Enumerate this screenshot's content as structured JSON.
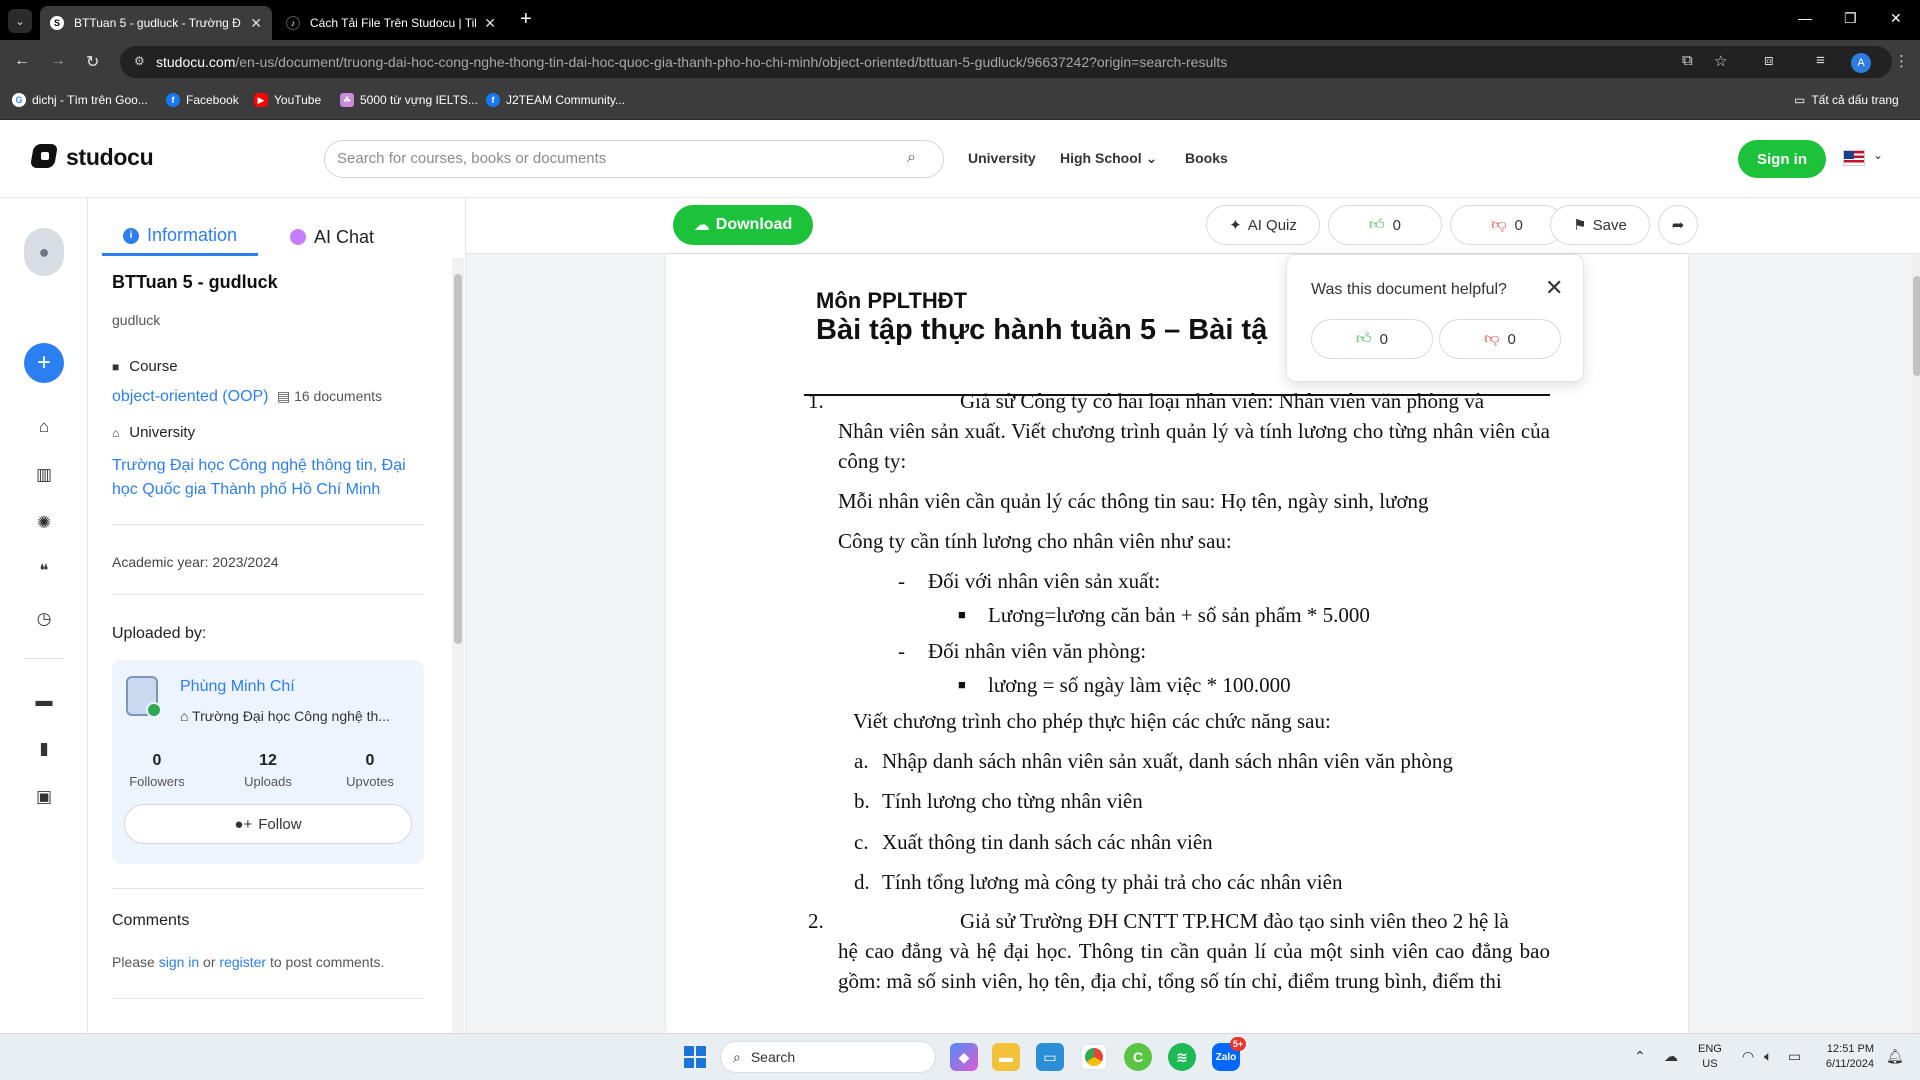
{
  "browser": {
    "tabs": [
      {
        "title": "BTTuan 5 - gudluck - Trường Đ",
        "active": true,
        "favicon": "studocu-icon"
      },
      {
        "title": "Cách Tải File Trên Studocu | Tik",
        "active": false,
        "favicon": "tiktok-icon"
      }
    ],
    "new_tab": "+",
    "window_controls": {
      "minimize": "—",
      "restore": "❐",
      "close": "✕"
    },
    "url_host": "studocu.com",
    "url_path": "/en-us/document/truong-dai-hoc-cong-nghe-thong-tin-dai-hoc-quoc-gia-thanh-pho-ho-chi-minh/object-oriented/bttuan-5-gudluck/96637242?origin=search-results",
    "profile_initial": "A",
    "bookmarks": [
      {
        "label": "dichj - Tìm trên Goo...",
        "icon": "google-icon",
        "color": "#ffffff"
      },
      {
        "label": "Facebook",
        "icon": "facebook-icon",
        "color": "#1877f2"
      },
      {
        "label": "YouTube",
        "icon": "youtube-icon",
        "color": "#ff0000"
      },
      {
        "label": "5000 từ vựng IELTS...",
        "icon": "ielts-icon",
        "color": "#c98bd9"
      },
      {
        "label": "J2TEAM Community...",
        "icon": "facebook-icon",
        "color": "#1877f2"
      }
    ],
    "all_bookmarks": "Tất cả dấu trang"
  },
  "site": {
    "logo_text": "studocu",
    "search_placeholder": "Search for courses, books or documents",
    "nav": [
      "University",
      "High School",
      "Books"
    ],
    "sign_in": "Sign in",
    "brand_color": "#1cc33a",
    "accent_color": "#2b7ff0"
  },
  "panel": {
    "tab_info": "Information",
    "tab_ai": "AI Chat",
    "doc_title": "BTTuan 5 - gudluck",
    "owner": "gudluck",
    "course_label": "Course",
    "course_name": "object-oriented (OOP)",
    "course_count": "16 documents",
    "university_label": "University",
    "university_name": "Trường Đại học Công nghệ thông tin, Đại học Quốc gia Thành phố Hồ Chí Minh",
    "academic_year": "Academic year: 2023/2024",
    "uploaded_by": "Uploaded by:",
    "uploader_name": "Phùng Minh Chí",
    "uploader_school": "Trường Đại học Công nghệ th...",
    "stats": [
      {
        "num": "0",
        "label": "Followers"
      },
      {
        "num": "12",
        "label": "Uploads"
      },
      {
        "num": "0",
        "label": "Upvotes"
      }
    ],
    "follow": "Follow",
    "comments_title": "Comments",
    "comments_prefix": "Please ",
    "comments_signin": "sign in",
    "comments_or": " or ",
    "comments_register": "register",
    "comments_suffix": " to post comments."
  },
  "toolbar": {
    "download": "Download",
    "ai_quiz": "AI Quiz",
    "likes": "0",
    "dislikes": "0",
    "save": "Save"
  },
  "popup": {
    "question": "Was this document helpful?",
    "likes": "0",
    "dislikes": "0"
  },
  "document": {
    "subject": "Môn PPLTHĐT",
    "title": "Bài tập thực hành tuần 5 – Bài tậ",
    "q1_num": "1.",
    "q1_line1": "Giả sử Công ty có hai loại nhân viên: Nhân viên văn phòng và",
    "q1_rest": "Nhân viên sản xuất. Viết chương trình quản lý và tính lương cho từng nhân viên của công ty:",
    "info_line": "Mỗi nhân viên cần quản lý các thông tin sau: Họ tên, ngày sinh, lương",
    "salary_intro": "Công ty cần tính lương cho nhân viên như sau:",
    "dash1": "Đối với nhân viên sản xuất:",
    "bullet1": "Lương=lương căn bản + số sản phẩm * 5.000",
    "dash2": "Đối nhân viên văn phòng:",
    "bullet2": "lương = số ngày làm việc * 100.000",
    "features_intro": "Viết chương trình cho phép thực hiện các chức năng sau:",
    "items": [
      {
        "letter": "a.",
        "text": "Nhập danh sách nhân viên sản xuất, danh sách nhân viên văn phòng"
      },
      {
        "letter": "b.",
        "text": "Tính lương cho từng nhân viên"
      },
      {
        "letter": "c.",
        "text": "Xuất thông tin danh sách các nhân viên"
      },
      {
        "letter": "d.",
        "text": "Tính tổng lương mà công ty phải trả cho các nhân viên"
      }
    ],
    "q2_num": "2.",
    "q2_line1": "Giả sử Trường ĐH CNTT TP.HCM đào tạo sinh viên theo 2 hệ là",
    "q2_rest": "hệ cao đẳng và hệ đại học. Thông tin cần quản lí của một sinh viên cao đẳng bao gồm: mã số sinh viên, họ tên, địa chỉ, tổng số tín chỉ, điểm trung bình, điểm thi"
  },
  "taskbar": {
    "search": "Search",
    "lang_top": "ENG",
    "lang_bottom": "US",
    "time": "12:51 PM",
    "date": "6/11/2024",
    "zalo_badge": "5+"
  }
}
